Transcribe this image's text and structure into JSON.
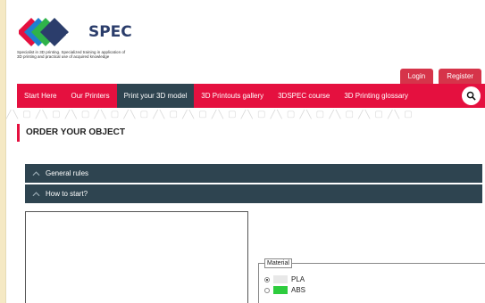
{
  "logo": {
    "brand_prefix": "3D",
    "brand_suffix": "SPEC",
    "tagline": "Specialist in 3D printing. Specialized training in application of 3D printing and practical use of acquired knowledge"
  },
  "auth": {
    "login": "Login",
    "register": "Register"
  },
  "nav": {
    "items": [
      "Start Here",
      "Our Printers",
      "Print your 3D model",
      "3D Printouts gallery",
      "3DSPEC course",
      "3D Printing glossary"
    ],
    "active_index": 2
  },
  "page_title": "ORDER YOUR OBJECT",
  "accordions": [
    "General rules",
    "How to start?"
  ],
  "material": {
    "legend": "Material",
    "options": [
      {
        "label": "PLA",
        "color": "#e8e8e8",
        "checked": true
      },
      {
        "label": "ABS",
        "color": "#2ecc3e",
        "checked": false
      }
    ]
  },
  "colors": {
    "accent": "#e5103f",
    "dark": "#2e4450",
    "button": "#d6344a",
    "background": "#f5e9c4"
  }
}
